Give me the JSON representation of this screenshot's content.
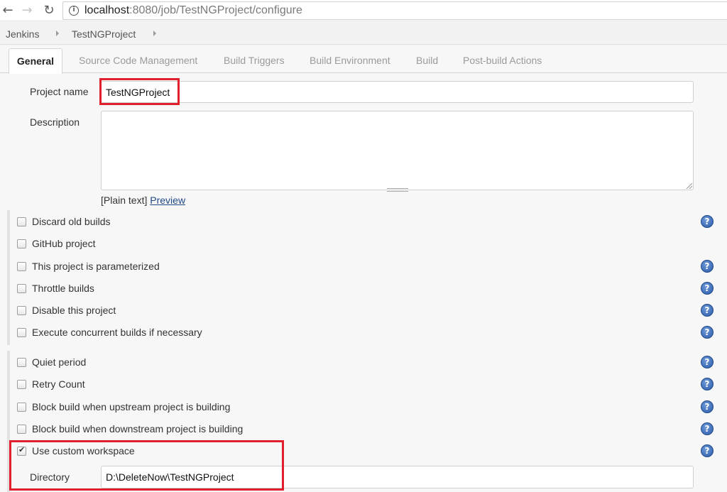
{
  "browser": {
    "url_host": "localhost",
    "url_path": ":8080/job/TestNGProject/configure",
    "back_glyph": "←",
    "forward_glyph": "→",
    "reload_glyph": "↻",
    "info_glyph": "i"
  },
  "breadcrumb": [
    {
      "label": "Jenkins"
    },
    {
      "label": "TestNGProject"
    }
  ],
  "tabs": [
    {
      "label": "General",
      "active": true
    },
    {
      "label": "Source Code Management"
    },
    {
      "label": "Build Triggers"
    },
    {
      "label": "Build Environment"
    },
    {
      "label": "Build"
    },
    {
      "label": "Post-build Actions"
    }
  ],
  "general": {
    "project_name_label": "Project name",
    "project_name_value": "TestNGProject",
    "description_label": "Description",
    "description_value": "",
    "plain_text": "[Plain text]",
    "preview_link": "Preview"
  },
  "options_group1": [
    {
      "label": "Discard old builds",
      "checked": false,
      "help": true
    },
    {
      "label": "GitHub project",
      "checked": false,
      "help": false
    },
    {
      "label": "This project is parameterized",
      "checked": false,
      "help": true
    },
    {
      "label": "Throttle builds",
      "checked": false,
      "help": true
    },
    {
      "label": "Disable this project",
      "checked": false,
      "help": true
    },
    {
      "label": "Execute concurrent builds if necessary",
      "checked": false,
      "help": true
    }
  ],
  "options_group2": [
    {
      "label": "Quiet period",
      "checked": false,
      "help": true
    },
    {
      "label": "Retry Count",
      "checked": false,
      "help": true
    },
    {
      "label": "Block build when upstream project is building",
      "checked": false,
      "help": true
    },
    {
      "label": "Block build when downstream project is building",
      "checked": false,
      "help": true
    },
    {
      "label": "Use custom workspace",
      "checked": true,
      "help": true
    }
  ],
  "workspace": {
    "directory_label": "Directory",
    "directory_value": "D:\\DeleteNow\\TestNGProject"
  },
  "help_glyph": "?",
  "colors": {
    "highlight": "#e0202a",
    "link": "#204a87",
    "help_icon": "#2a5aa8"
  }
}
